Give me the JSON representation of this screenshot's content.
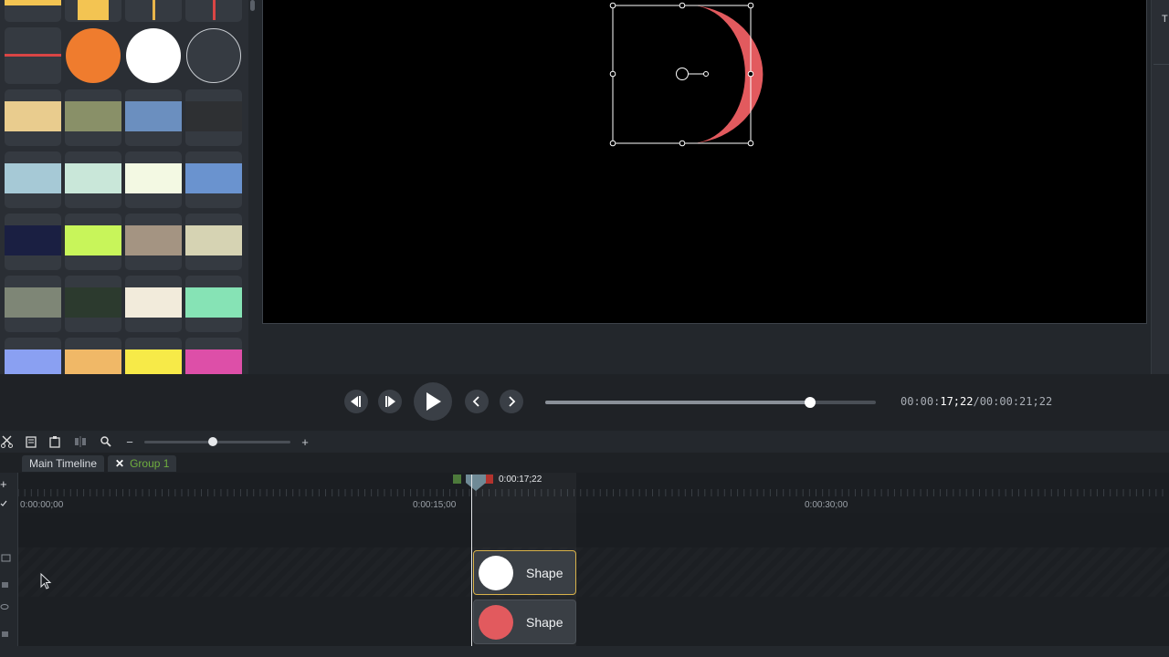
{
  "assets": {
    "colors": {
      "row0": [
        "#f3c452",
        "#f3c452",
        "#e8b54a",
        "#d94545"
      ],
      "row2": [
        "#e9cc8e",
        "#899068",
        "#6b8fbf",
        "#2e3033"
      ],
      "row3": [
        "#a6c9d6",
        "#c9e7d9",
        "#f3f9e3",
        "#6a93cf"
      ],
      "row4": [
        "#1a1f42",
        "#c8f55a",
        "#a49482",
        "#d6d3b3"
      ],
      "row5": [
        "#7e8676",
        "#2c3a2e",
        "#f2ebdb",
        "#86e3b5"
      ],
      "row6": [
        "#8aa0f2",
        "#f0b867",
        "#f7ea48",
        "#dd4fa8"
      ]
    },
    "circles": {
      "orange": "#ef7c2e",
      "white": "#ffffff",
      "dark": "#363b42"
    },
    "line_color": "#d94545"
  },
  "right_rail": {
    "label": "T"
  },
  "playback": {
    "progress": 0.8,
    "timecode_prefix": "00:00:",
    "timecode_current": "17;22",
    "timecode_total": "/00:00:21;22"
  },
  "toolbar": {
    "zoom_minus": "−",
    "zoom_plus": "+",
    "zoom_level": 0.47
  },
  "tabs": {
    "main": "Main Timeline",
    "group": "Group 1",
    "group_color": "#6fae3f"
  },
  "timeline": {
    "ruler_labels": [
      "0:00:00;00",
      "0:00:15;00",
      "0:00:30;00"
    ],
    "playhead_time": "0:00:17;22",
    "clips": [
      {
        "label": "Shape",
        "color": "#ffffff"
      },
      {
        "label": "Shape",
        "color": "#e25a5e"
      }
    ]
  },
  "canvas": {
    "shape_color": "#e25a5e"
  }
}
